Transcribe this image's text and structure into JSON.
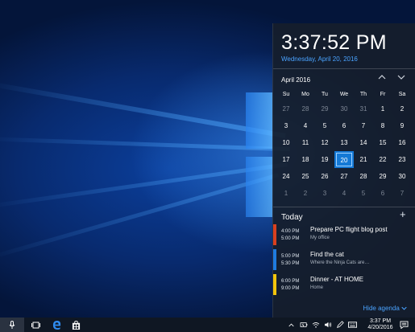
{
  "flyout": {
    "time": "3:37:52 PM",
    "date_long": "Wednesday, April 20, 2016",
    "month_label": "April 2016",
    "weekdays": [
      "Su",
      "Mo",
      "Tu",
      "We",
      "Th",
      "Fr",
      "Sa"
    ],
    "weeks": [
      [
        "27",
        "28",
        "29",
        "30",
        "31",
        "1",
        "2"
      ],
      [
        "3",
        "4",
        "5",
        "6",
        "7",
        "8",
        "9"
      ],
      [
        "10",
        "11",
        "12",
        "13",
        "14",
        "15",
        "16"
      ],
      [
        "17",
        "18",
        "19",
        "20",
        "21",
        "22",
        "23"
      ],
      [
        "24",
        "25",
        "26",
        "27",
        "28",
        "29",
        "30"
      ],
      [
        "1",
        "2",
        "3",
        "4",
        "5",
        "6",
        "7"
      ]
    ],
    "today_label": "Today",
    "add_label": "+",
    "events": [
      {
        "time": "4:00 PM\n5:00 PM",
        "title": "Prepare PC flight blog post",
        "sub": "My office",
        "color": "#d9401f"
      },
      {
        "time": "5:00 PM\n5:30 PM",
        "title": "Find the cat",
        "sub": "Where the Ninja Cats are…",
        "color": "#1e7be0"
      },
      {
        "time": "6:00 PM\n9:00 PM",
        "title": "Dinner - AT HOME",
        "sub": "Home",
        "color": "#f2c40c"
      }
    ],
    "hide_agenda_label": "Hide agenda"
  },
  "taskbar": {
    "time": "3:37 PM",
    "date": "4/20/2016"
  },
  "icons": {
    "up": "chevron-up-icon",
    "down": "chevron-down-icon",
    "mic": "microphone-icon",
    "taskview": "task-view-icon",
    "edge": "edge-icon",
    "store": "store-icon",
    "notif": "action-center-icon"
  }
}
